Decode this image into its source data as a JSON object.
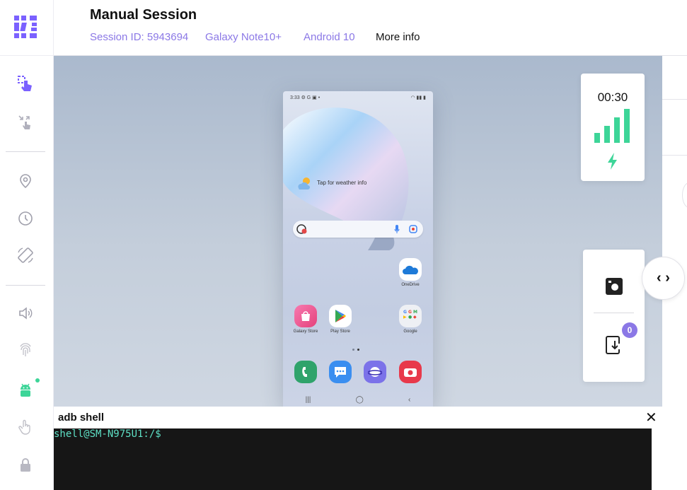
{
  "header": {
    "title": "Manual Session",
    "session_id": "Session ID: 5943694",
    "device": "Galaxy Note10+",
    "os": "Android 10",
    "more_info": "More info"
  },
  "sidebar": {
    "items": [
      {
        "icon": "touch-select-icon",
        "active": true
      },
      {
        "icon": "shrink-touch-icon"
      },
      {
        "icon": "location-pin-icon"
      },
      {
        "icon": "clock-icon"
      },
      {
        "icon": "rotate-icon"
      },
      {
        "icon": "volume-icon"
      },
      {
        "icon": "fingerprint-icon"
      },
      {
        "icon": "android-icon",
        "status": "online"
      },
      {
        "icon": "gesture-hand-icon"
      },
      {
        "icon": "lock-icon"
      }
    ]
  },
  "phone": {
    "status_time": "3:33",
    "weather_text": "Tap for weather info",
    "apps": {
      "onedrive": "OneDrive",
      "galaxy_store": "Galaxy Store",
      "play_store": "Play Store",
      "google": "Google"
    }
  },
  "network": {
    "timer": "00:30",
    "signal_level": "4 of 4 bars",
    "status_color": "#3dd598"
  },
  "tools": {
    "file_badge": "0"
  },
  "adb": {
    "title": "adb shell",
    "prompt": "shell@SM-N975U1:/$"
  },
  "colors": {
    "accent": "#8b78e6",
    "signal": "#3dd598",
    "terminal_bg": "#161616",
    "terminal_text": "#5ee0c5"
  }
}
